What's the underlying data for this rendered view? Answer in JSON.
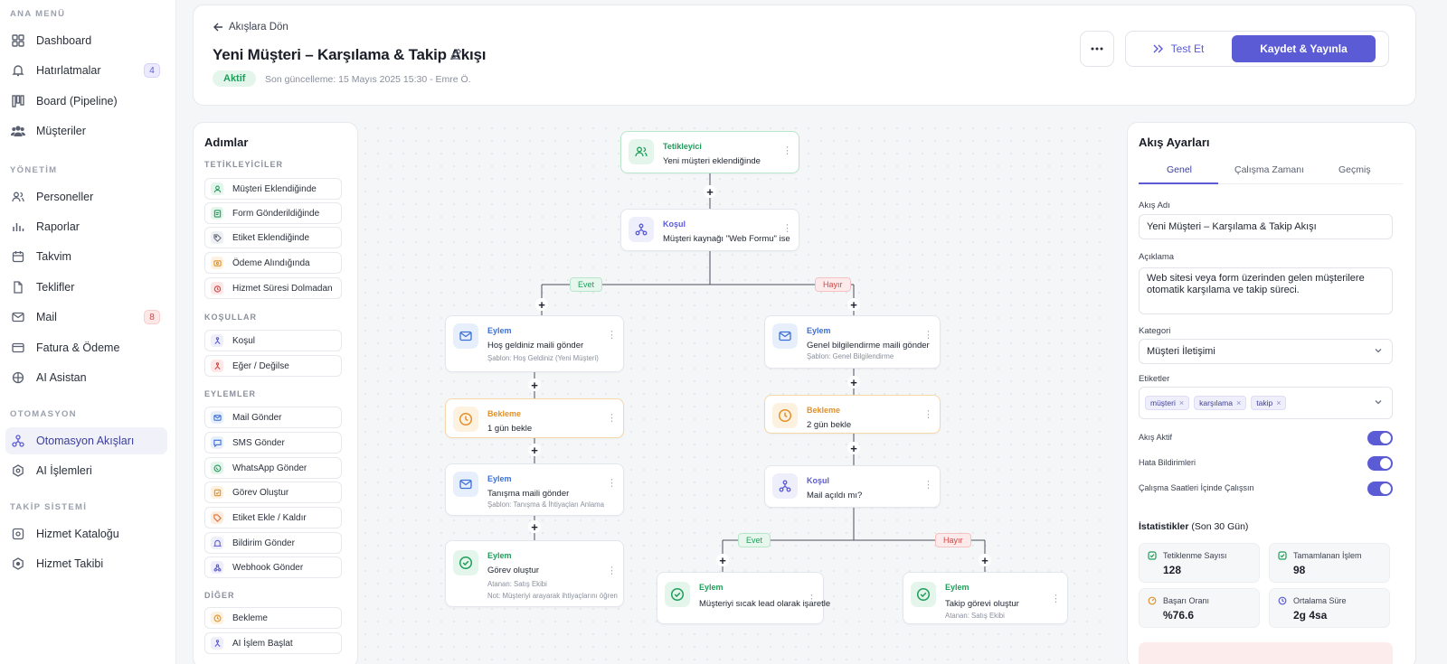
{
  "sidebar": {
    "sections": [
      {
        "title": "ANA MENÜ",
        "items": [
          {
            "label": "Dashboard",
            "icon": "grid-icon"
          },
          {
            "label": "Hatırlatmalar",
            "icon": "bell-icon",
            "badge": "4"
          },
          {
            "label": "Board (Pipeline)",
            "icon": "kanban-icon"
          },
          {
            "label": "Müşteriler",
            "icon": "users-icon"
          }
        ]
      },
      {
        "title": "YÖNETİM",
        "items": [
          {
            "label": "Personeller",
            "icon": "user-group-icon"
          },
          {
            "label": "Raporlar",
            "icon": "bar-chart-icon"
          },
          {
            "label": "Takvim",
            "icon": "calendar-icon"
          },
          {
            "label": "Teklifler",
            "icon": "document-icon"
          },
          {
            "label": "Mail",
            "icon": "mail-icon",
            "badge": "8"
          },
          {
            "label": "Fatura & Ödeme",
            "icon": "credit-card-icon"
          },
          {
            "label": "AI Asistan",
            "icon": "ai-icon"
          }
        ]
      },
      {
        "title": "OTOMASYON",
        "items": [
          {
            "label": "Otomasyon Akışları",
            "icon": "workflow-icon",
            "active": true
          },
          {
            "label": "AI İşlemleri",
            "icon": "hexagon-icon"
          }
        ]
      },
      {
        "title": "TAKİP SİSTEMİ",
        "items": [
          {
            "label": "Hizmet Kataloğu",
            "icon": "catalog-icon"
          },
          {
            "label": "Hizmet Takibi",
            "icon": "target-icon"
          }
        ]
      }
    ]
  },
  "header": {
    "back_label": "Akışlara Dön",
    "title": "Yeni Müşteri – Karşılama & Takip Akışı",
    "status": "Aktif",
    "updated": "Son güncelleme: 15 Mayıs 2025 15:30 - Emre Ö.",
    "test_label": "Test Et",
    "save_label": "Kaydet & Yayınla"
  },
  "steps_panel": {
    "title": "Adımlar",
    "groups": [
      {
        "title": "TETİKLEYİCİLER",
        "items": [
          {
            "label": "Müşteri Eklendiğinde",
            "icon": "user-icon",
            "color": "#1f9d5a"
          },
          {
            "label": "Form Gönderildiğinde",
            "icon": "form-icon",
            "color": "#1f9d5a"
          },
          {
            "label": "Etiket Eklendiğinde",
            "icon": "tag-icon",
            "color": "#6a7080"
          },
          {
            "label": "Ödeme Alındığında",
            "icon": "payment-icon",
            "color": "#e0912c"
          },
          {
            "label": "Hizmet Süresi Dolmadan",
            "icon": "alarm-icon",
            "color": "#d24646"
          }
        ]
      },
      {
        "title": "KOŞULLAR",
        "items": [
          {
            "label": "Koşul",
            "icon": "branch-icon",
            "color": "#5b5bd6"
          },
          {
            "label": "Eğer / Değilse",
            "icon": "if-else-icon",
            "color": "#d24646"
          }
        ]
      },
      {
        "title": "EYLEMLER",
        "items": [
          {
            "label": "Mail Gönder",
            "icon": "mail-icon",
            "color": "#3b6fd6"
          },
          {
            "label": "SMS Gönder",
            "icon": "sms-icon",
            "color": "#3b6fd6"
          },
          {
            "label": "WhatsApp Gönder",
            "icon": "whatsapp-icon",
            "color": "#1f9d5a"
          },
          {
            "label": "Görev Oluştur",
            "icon": "task-icon",
            "color": "#e0912c"
          },
          {
            "label": "Etiket Ekle / Kaldır",
            "icon": "tag-icon",
            "color": "#e06a2c"
          },
          {
            "label": "Bildirim Gönder",
            "icon": "bell-icon",
            "color": "#5b5bd6"
          },
          {
            "label": "Webhook Gönder",
            "icon": "webhook-icon",
            "color": "#5b5bd6"
          }
        ]
      },
      {
        "title": "DİĞER",
        "items": [
          {
            "label": "Bekleme",
            "icon": "clock-icon",
            "color": "#e0912c"
          },
          {
            "label": "AI İşlem Başlat",
            "icon": "ai-icon",
            "color": "#5b5bd6"
          }
        ]
      }
    ]
  },
  "flow": {
    "trigger": {
      "type": "Tetikleyici",
      "label": "Yeni müşteri eklendiğinde"
    },
    "condition1": {
      "type": "Koşul",
      "label": "Müşteri kaynağı \"Web Formu\" ise"
    },
    "branch_yes": "Evet",
    "branch_no": "Hayır",
    "left_action1": {
      "type": "Eylem",
      "label": "Hoş geldiniz maili gönder",
      "sub": "Şablon: Hoş Geldiniz (Yeni Müşteri)"
    },
    "left_wait": {
      "type": "Bekleme",
      "label": "1 gün bekle"
    },
    "left_action2": {
      "type": "Eylem",
      "label": "Tanışma maili gönder",
      "sub": "Şablon: Tanışma & İhtiyaçları Anlama"
    },
    "left_task": {
      "type": "Eylem",
      "label": "Görev oluştur",
      "sub1": "Atanan: Satış Ekibi",
      "sub2": "Not: Müşteriyi arayarak ihtiyaçlarını öğren"
    },
    "right_action1": {
      "type": "Eylem",
      "label": "Genel bilgilendirme maili gönder",
      "sub": "Şablon: Genel Bilgilendirme"
    },
    "right_wait": {
      "type": "Bekleme",
      "label": "2 gün bekle"
    },
    "condition2": {
      "type": "Koşul",
      "label": "Mail açıldı mı?"
    },
    "branch2_yes": "Evet",
    "branch2_no": "Hayır",
    "hot_lead": {
      "type": "Eylem",
      "label": "Müşteriyi sıcak lead olarak işaretle"
    },
    "followup": {
      "type": "Eylem",
      "label": "Takip görevi oluştur",
      "sub": "Atanan: Satış Ekibi"
    }
  },
  "settings": {
    "title": "Akış Ayarları",
    "tabs": [
      "Genel",
      "Çalışma Zamanı",
      "Geçmiş"
    ],
    "name_label": "Akış Adı",
    "name_value": "Yeni Müşteri – Karşılama & Takip Akışı",
    "desc_label": "Açıklama",
    "desc_value": "Web sitesi veya form üzerinden gelen müşterilere otomatik karşılama ve takip süreci.",
    "category_label": "Kategori",
    "category_value": "Müşteri İletişimi",
    "tags_label": "Etiketler",
    "tags": [
      "müşteri",
      "karşılama",
      "takip"
    ],
    "toggles": [
      {
        "label": "Akış Aktif",
        "on": true
      },
      {
        "label": "Hata Bildirimleri",
        "on": true
      },
      {
        "label": "Çalışma Saatleri İçinde Çalışsın",
        "on": true
      }
    ],
    "stats_title": "İstatistikler",
    "stats_period": "(Son 30 Gün)",
    "stats": [
      {
        "label": "Tetiklenme Sayısı",
        "value": "128",
        "color": "#1f9d5a"
      },
      {
        "label": "Tamamlanan İşlem",
        "value": "98",
        "color": "#1f9d5a"
      },
      {
        "label": "Başarı Oranı",
        "value": "%76.6",
        "color": "#e0912c"
      },
      {
        "label": "Ortalama Süre",
        "value": "2g 4sa",
        "color": "#5b5bd6"
      }
    ]
  },
  "colors": {
    "accent": "#5b5bd6",
    "success": "#1f9d5a",
    "warning": "#e0912c",
    "danger": "#d24646"
  }
}
